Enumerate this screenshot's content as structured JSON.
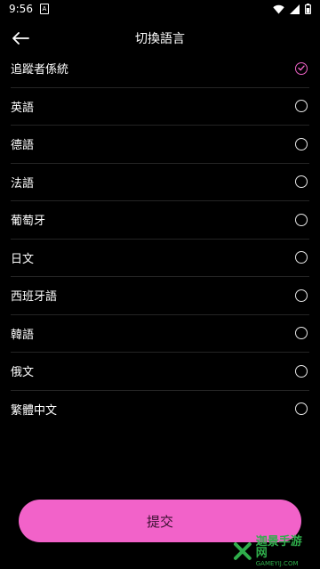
{
  "status_bar": {
    "time": "9:56",
    "sim_label": "A"
  },
  "header": {
    "title": "切換語言"
  },
  "languages": [
    {
      "label": "追蹤者係統",
      "selected": true
    },
    {
      "label": "英語",
      "selected": false
    },
    {
      "label": "德語",
      "selected": false
    },
    {
      "label": "法語",
      "selected": false
    },
    {
      "label": "葡萄牙",
      "selected": false
    },
    {
      "label": "日文",
      "selected": false
    },
    {
      "label": "西班牙語",
      "selected": false
    },
    {
      "label": "韓語",
      "selected": false
    },
    {
      "label": "俄文",
      "selected": false
    },
    {
      "label": "繁體中文",
      "selected": false
    }
  ],
  "submit_label": "提交",
  "watermark": {
    "main": "迦景手游网",
    "sub": "GAMEYIJ.COM"
  },
  "colors": {
    "accent": "#f262c9",
    "background": "#000000"
  }
}
